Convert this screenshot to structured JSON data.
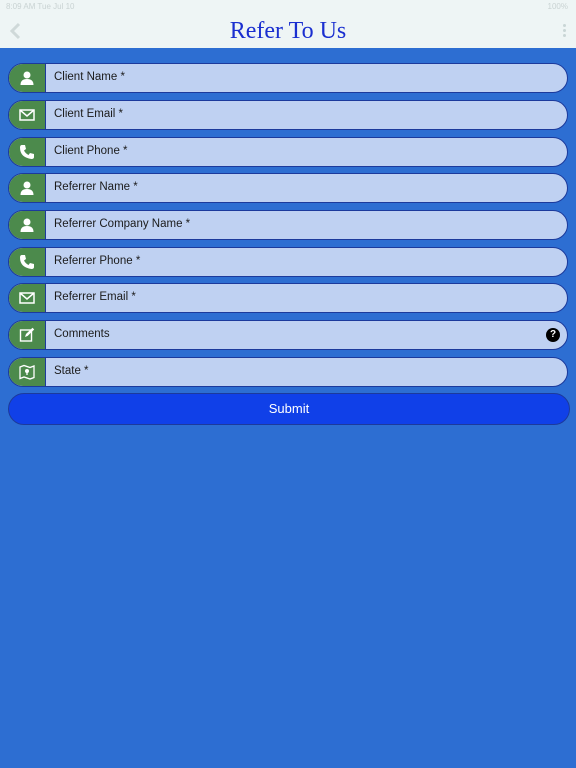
{
  "status_bar": {
    "left": "8:09 AM  Tue Jul 10",
    "right": "100%"
  },
  "header": {
    "title": "Refer To Us"
  },
  "form": {
    "fields": [
      {
        "label": "Client Name *",
        "icon": "person-icon"
      },
      {
        "label": "Client Email *",
        "icon": "envelope-icon"
      },
      {
        "label": "Client Phone *",
        "icon": "phone-icon"
      },
      {
        "label": "Referrer Name *",
        "icon": "person-icon"
      },
      {
        "label": "Referrer Company Name *",
        "icon": "person-icon"
      },
      {
        "label": "Referrer Phone *",
        "icon": "phone-icon"
      },
      {
        "label": "Referrer Email *",
        "icon": "envelope-icon"
      },
      {
        "label": "Comments",
        "icon": "edit-icon"
      },
      {
        "label": "State *",
        "icon": "map-icon"
      }
    ],
    "help_symbol": "?",
    "submit_label": "Submit"
  },
  "colors": {
    "background": "#2d6ed2",
    "field_fill": "#bfd1f2",
    "icon_fill": "#4c8a4c",
    "submit_fill": "#1040e8",
    "title_color": "#1a2fd0"
  }
}
